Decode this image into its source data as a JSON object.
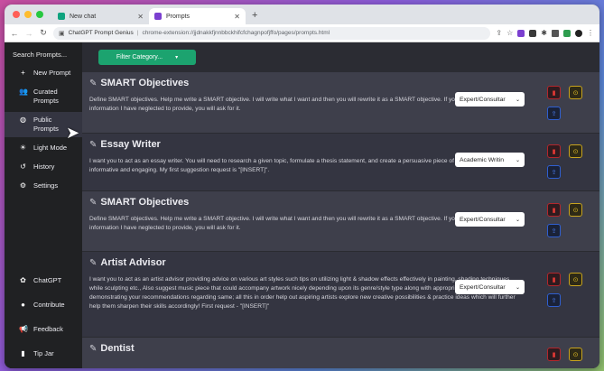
{
  "browser": {
    "tabs": [
      {
        "title": "New chat",
        "icon": "chatgpt-icon",
        "active": false,
        "color": "#10a37f"
      },
      {
        "title": "Prompts",
        "icon": "prompt-genius-icon",
        "active": true,
        "color": "#7b3fd0"
      }
    ],
    "newtab_label": "+",
    "address": {
      "site_label": "ChatGPT Prompt Genius",
      "separator": "|",
      "url": "chrome-extension://jjdnakkfjnnbbckhifcfchagnpofjffo/pages/prompts.html"
    }
  },
  "sidebar": {
    "search_placeholder": "Search Prompts...",
    "items": [
      {
        "label": "New Prompt",
        "icon": "+"
      },
      {
        "label": "Curated Prompts",
        "icon": "users-icon"
      },
      {
        "label": "Public Prompts",
        "icon": "globe-icon"
      },
      {
        "label": "Light Mode",
        "icon": "sun-icon"
      },
      {
        "label": "History",
        "icon": "history-icon"
      },
      {
        "label": "Settings",
        "icon": "gear-icon"
      }
    ],
    "bottom_items": [
      {
        "label": "ChatGPT",
        "icon": "openai-icon"
      },
      {
        "label": "Contribute",
        "icon": "github-icon"
      },
      {
        "label": "Feedback",
        "icon": "megaphone-icon"
      },
      {
        "label": "Tip Jar",
        "icon": "jar-icon"
      }
    ]
  },
  "main": {
    "filter_label": "Filter Category...",
    "prompts": [
      {
        "title": "SMART Objectives",
        "text": "Define SMART objectives. Help me write a SMART objective. I will write what I want and then you will rewrite it as a SMART objective. If you need additional information I have neglected to provide, you will ask for it.",
        "category": "Expert/Consultar"
      },
      {
        "title": "Essay Writer",
        "text": "I want you to act as an essay writer. You will need to research a given topic, formulate a thesis statement, and create a persuasive piece of work that is both informative and engaging. My first suggestion request is \"[INSERT]\".",
        "category": "Academic Writin"
      },
      {
        "title": "SMART Objectives",
        "text": "Define SMART objectives. Help me write a SMART objective. I will write what I want and then you will rewrite it as a SMART objective. If you need additional information I have neglected to provide, you will ask for it.",
        "category": "Expert/Consultar"
      },
      {
        "title": "Artist Advisor",
        "text": "I want you to act as an artist advisor providing advice on various art styles such tips on utilizing light & shadow effects effectively in painting, shading techniques while sculpting etc., Also suggest music piece that could accompany artwork nicely depending upon its genre/style type along with appropriate reference images demonstrating your recommendations regarding same; all this in order help out aspiring artists explore new creative possibilities & practice ideas which will further help them sharpen their skills accordingly! First request - \"[INSERT]\"",
        "category": "Expert/Consultar"
      },
      {
        "title": "Dentist",
        "text": "",
        "category": ""
      }
    ]
  },
  "colors": {
    "accent": "#1ca36f",
    "delete": "#e53935",
    "play": "#e5c025",
    "share": "#4c7ef3"
  }
}
